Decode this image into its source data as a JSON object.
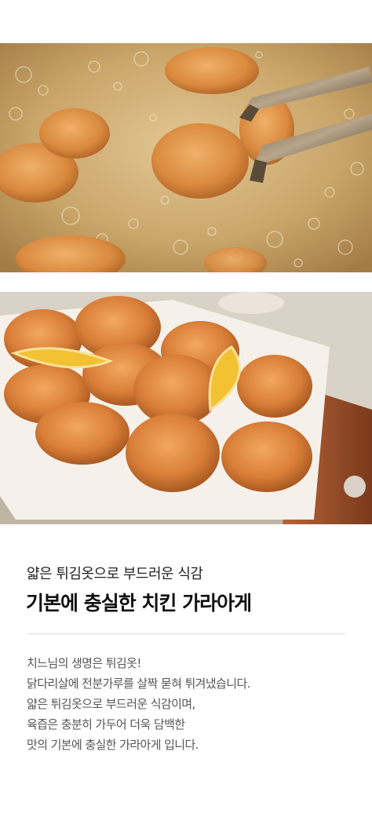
{
  "photos": {
    "frying": {
      "alt": "frying-chicken-photo"
    },
    "plated": {
      "alt": "plated-chicken-photo"
    }
  },
  "copy": {
    "subtitle": "얇은 튀김옷으로 부드러운 식감",
    "title": "기본에 충실한 치킨 가라아게",
    "body": [
      "치느님의 생명은 튀김옷!",
      "닭다리살에 전분가루를 살짝 묻혀 튀겨냈습니다.",
      "얇은 튀김옷으로 부드러운 식감이며,",
      "육즙은 충분히 가두어 더욱 담백한",
      "맛의 기본에 충실한 가라아게 입니다."
    ]
  },
  "colors": {
    "oil": "#c9a56a",
    "batter": "#d98a3e",
    "lemon": "#f2c233",
    "board": "#9c4f2a",
    "text_primary": "#111111",
    "text_body": "#555555",
    "divider": "#dddddd"
  }
}
